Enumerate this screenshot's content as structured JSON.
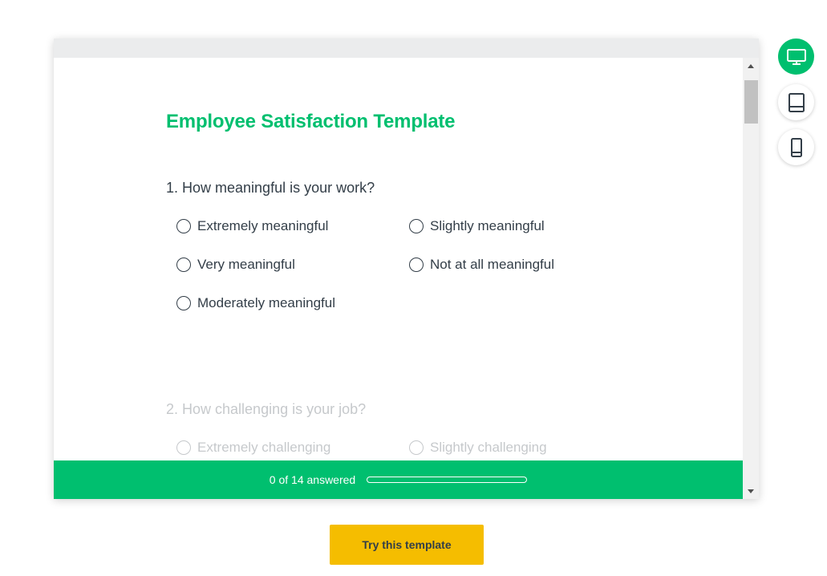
{
  "survey": {
    "title": "Employee Satisfaction Template",
    "questions": [
      {
        "text": "1. How meaningful is your work?",
        "options": [
          "Extremely meaningful",
          "Slightly meaningful",
          "Very meaningful",
          "Not at all meaningful",
          "Moderately meaningful"
        ]
      },
      {
        "text": "2. How challenging is your job?",
        "options": [
          "Extremely challenging",
          "Slightly challenging"
        ]
      }
    ]
  },
  "progress": {
    "text": "0 of 14 answered",
    "answered": 0,
    "total": 14
  },
  "device_toggle": {
    "selected": "desktop",
    "icons": [
      "desktop-icon",
      "tablet-icon",
      "mobile-icon"
    ]
  },
  "cta": {
    "label": "Try this template"
  },
  "colors": {
    "brand_green": "#00bf6f",
    "cta_yellow": "#f5bd00",
    "text_dark": "#333e48"
  }
}
